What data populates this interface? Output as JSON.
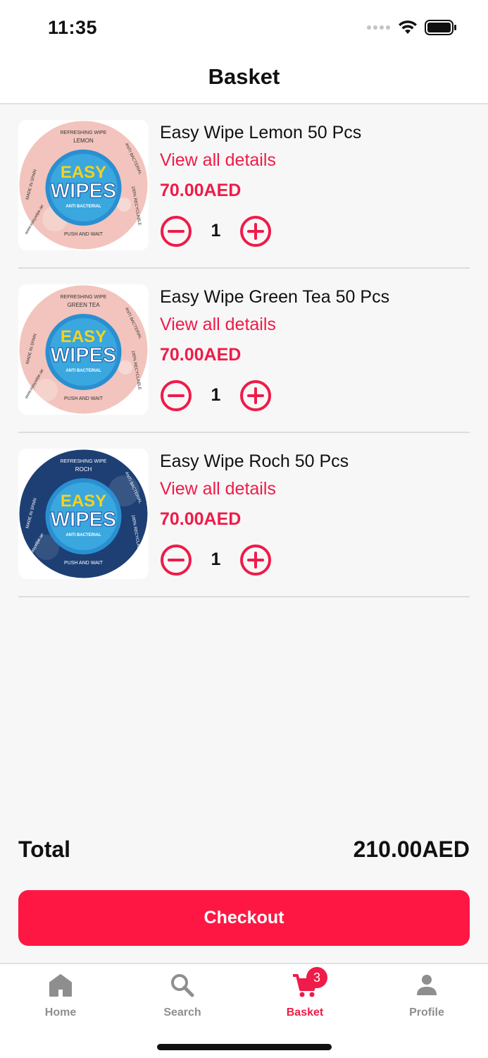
{
  "status_bar": {
    "time": "11:35",
    "icons": [
      "signal-dots-icon",
      "wifi-icon",
      "battery-icon"
    ]
  },
  "header": {
    "title": "Basket"
  },
  "basket": {
    "items": [
      {
        "name": "Easy Wipe Lemon 50 Pcs",
        "details_link": "View all details",
        "price": "70.00AED",
        "quantity": "1",
        "image": {
          "logo_top": "EASY",
          "logo_bottom": "WIPES",
          "logo_sub": "ANTI BACTERIAL",
          "label_top": "REFRESHING WIPE",
          "flavor": "LEMON",
          "label_bottom": "PUSH AND WAIT",
          "label_left": "MADE IN SPAIN",
          "label_right": "ANTI BACTERIAL",
          "label_right2": "100% RECYCLABLE",
          "label_left2": "www.easywipe.ae",
          "color": "#f2c4bd"
        }
      },
      {
        "name": "Easy Wipe Green Tea 50 Pcs",
        "details_link": "View all details",
        "price": "70.00AED",
        "quantity": "1",
        "image": {
          "logo_top": "EASY",
          "logo_bottom": "WIPES",
          "logo_sub": "ANTI BACTERIAL",
          "label_top": "REFRESHING WIPE",
          "flavor": "GREEN TEA",
          "label_bottom": "PUSH AND WAIT",
          "label_left": "MADE IN SPAIN",
          "label_right": "ANTI BACTERIAL",
          "label_right2": "100% RECYCLABLE",
          "label_left2": "www.easywipe.ae",
          "color": "#f2c4bd"
        }
      },
      {
        "name": "Easy Wipe Roch 50 Pcs",
        "details_link": "View all details",
        "price": "70.00AED",
        "quantity": "1",
        "image": {
          "logo_top": "EASY",
          "logo_bottom": "WIPES",
          "logo_sub": "ANTI BACTERIAL",
          "label_top": "REFRESHING WIPE",
          "flavor": "ROCH",
          "label_bottom": "PUSH AND WAIT",
          "label_left": "MADE IN SPAIN",
          "label_right": "ANTI BACTERIAL",
          "label_right2": "100% RECYCLABLE",
          "label_left2": "www.easywipe.ae",
          "color": "#1d3f74"
        }
      }
    ]
  },
  "summary": {
    "total_label": "Total",
    "total_value": "210.00AED"
  },
  "checkout": {
    "label": "Checkout"
  },
  "tab_bar": {
    "tabs": [
      {
        "label": "Home",
        "icon": "home-icon",
        "active": false
      },
      {
        "label": "Search",
        "icon": "search-icon",
        "active": false
      },
      {
        "label": "Basket",
        "icon": "cart-icon",
        "active": true,
        "badge": "3"
      },
      {
        "label": "Profile",
        "icon": "person-icon",
        "active": false
      }
    ]
  },
  "colors": {
    "accent": "#ef1b48",
    "checkout_bg": "#ff1744",
    "inactive_tab": "#8e8e8e",
    "background": "#f7f7f7"
  }
}
